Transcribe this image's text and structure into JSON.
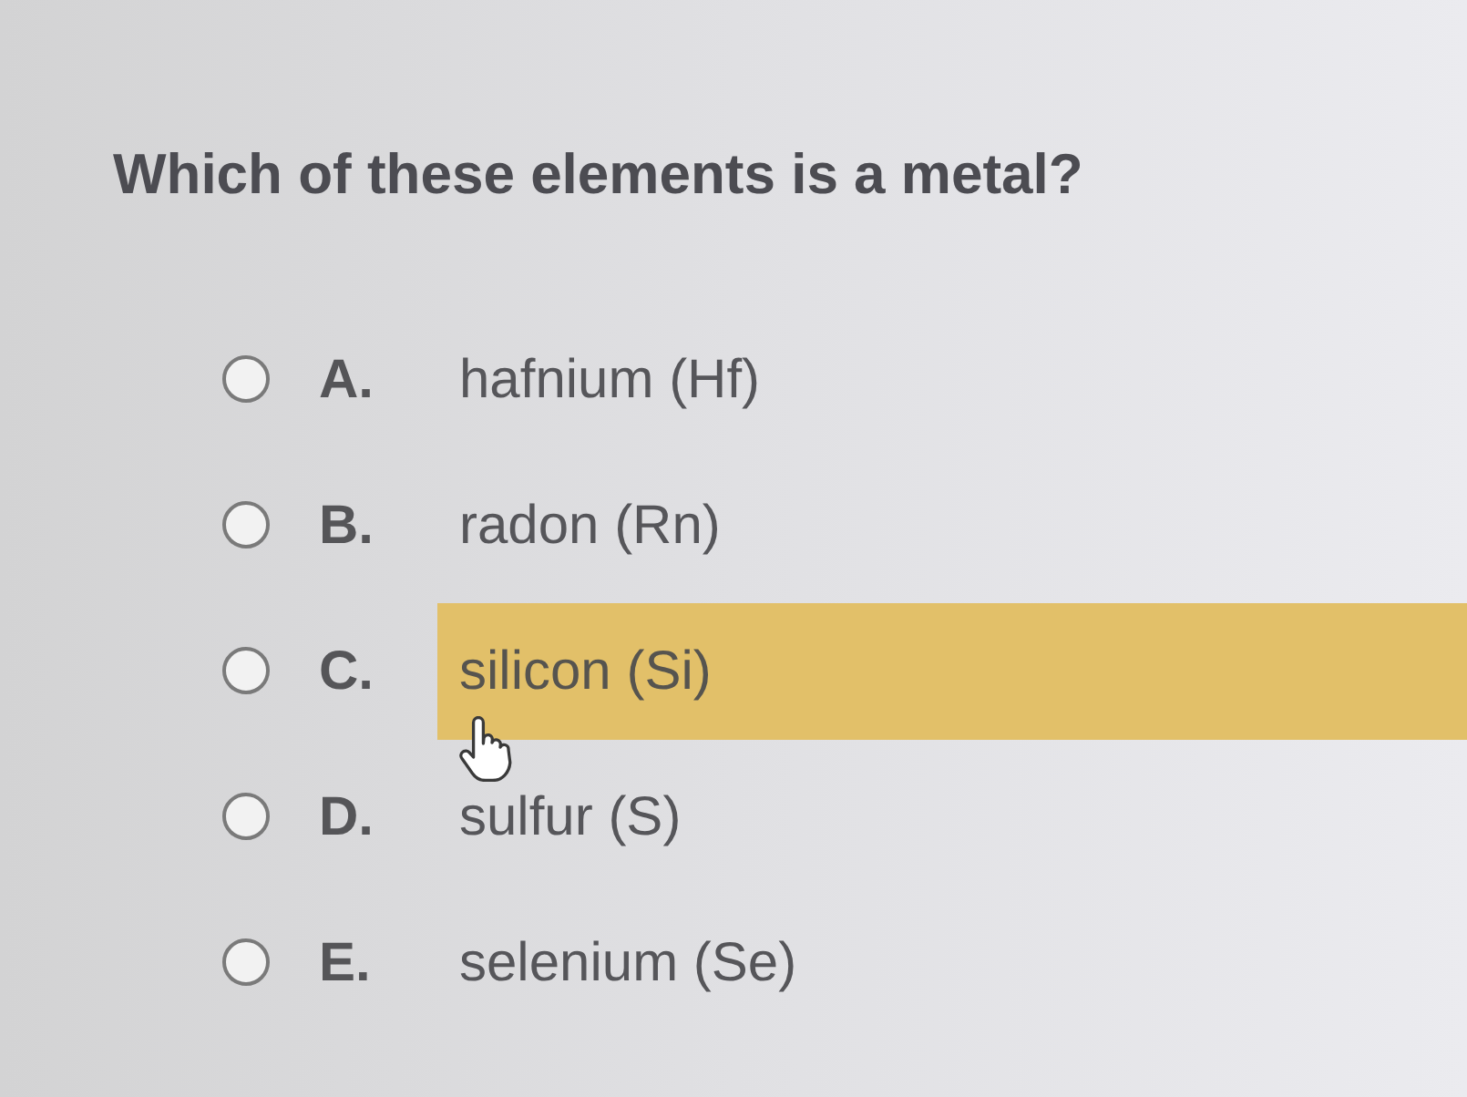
{
  "question": "Which of these elements is a metal?",
  "options": [
    {
      "letter": "A.",
      "text": "hafnium (Hf)",
      "selected": false,
      "hovered": false
    },
    {
      "letter": "B.",
      "text": "radon (Rn)",
      "selected": false,
      "hovered": false
    },
    {
      "letter": "C.",
      "text": "silicon (Si)",
      "selected": false,
      "hovered": true
    },
    {
      "letter": "D.",
      "text": "sulfur (S)",
      "selected": false,
      "hovered": false
    },
    {
      "letter": "E.",
      "text": "selenium (Se)",
      "selected": false,
      "hovered": false
    }
  ]
}
